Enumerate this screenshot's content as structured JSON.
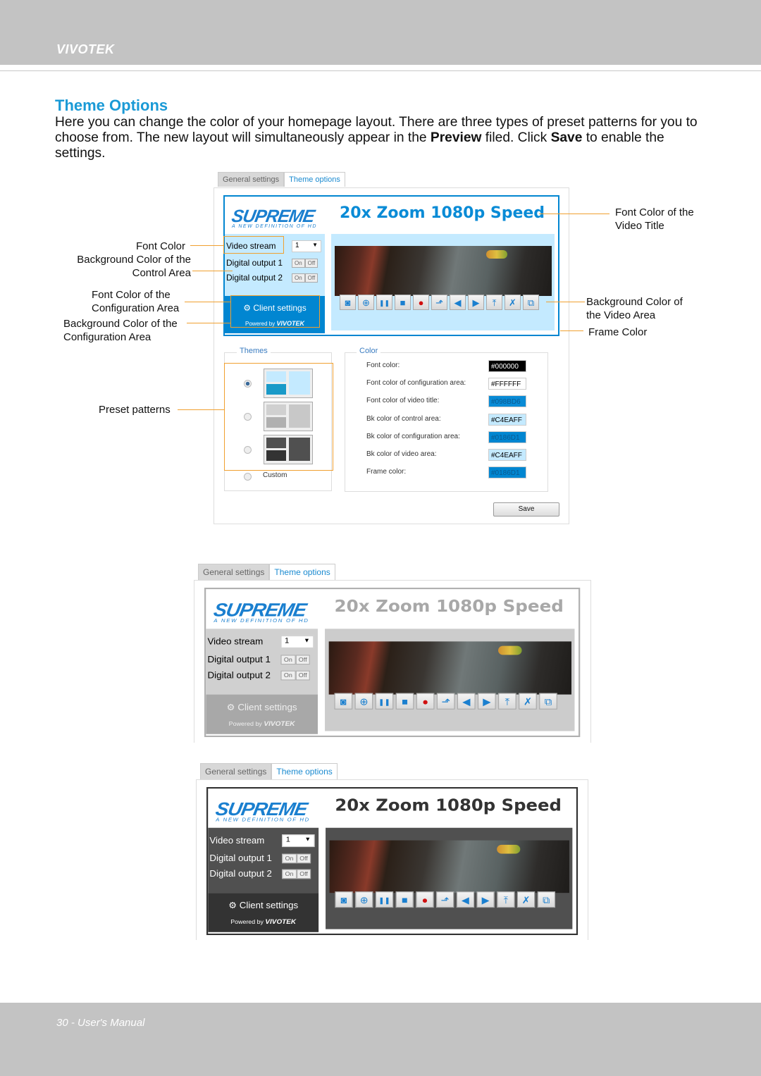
{
  "header": {
    "brand": "VIVOTEK"
  },
  "section": {
    "title": "Theme Options",
    "paragraph_parts": [
      "Here you can change the color of your homepage layout. There are three types of preset patterns for you to choose from. The new layout will simultaneously appear in the ",
      "Preview",
      " filed. Click ",
      "Save",
      " to enable the settings."
    ]
  },
  "callouts": {
    "font_color": "Font Color",
    "bg_control": [
      "Background Color of the",
      "Control Area"
    ],
    "font_config": [
      "Font Color of the",
      "Configuration Area"
    ],
    "bg_config": [
      "Background Color of the",
      "Configuration Area"
    ],
    "preset": "Preset patterns",
    "font_video_title": [
      "Font Color of the",
      "Video Title"
    ],
    "bg_video": [
      "Background Color of",
      "the Video Area"
    ],
    "frame": "Frame Color"
  },
  "tabs": {
    "general": "General settings",
    "theme": "Theme options"
  },
  "preview": {
    "logo": "SUPREME",
    "tagline": "A NEW DEFINITION OF HD",
    "video_title": "20x Zoom 1080p Speed",
    "video_stream_label": "Video stream",
    "video_stream_value": "1",
    "digital_output_1": "Digital output 1",
    "digital_output_2": "Digital output 2",
    "on": "On",
    "off": "Off",
    "client_settings": "Client settings",
    "powered_by": "Powered by",
    "powered_brand": "VIVOTEK",
    "buttons": [
      "snapshot-icon",
      "zoom-icon",
      "pause-icon",
      "stop-icon",
      "record-icon",
      "pan-icon",
      "speaker-icon",
      "talk-icon",
      "upload-icon",
      "mute-mic-icon",
      "fullscreen-icon"
    ]
  },
  "themes": [
    {
      "frame": "#0186D1",
      "title": "#098BD6",
      "control_bg": "#C4EAFF",
      "font": "#000000",
      "config_bg": "#0186D1",
      "config_font": "#FFFFFF",
      "video_bg": "#C4EAFF"
    },
    {
      "frame": "#B0B0B0",
      "title": "#A8A8A8",
      "control_bg": "#D0D0D0",
      "font": "#000000",
      "config_bg": "#A8A8A8",
      "config_font": "#EEEEEE",
      "video_bg": "#CCCCCC"
    },
    {
      "frame": "#333333",
      "title": "#333333",
      "control_bg": "#505050",
      "font": "#FFFFFF",
      "config_bg": "#333333",
      "config_font": "#FFFFFF",
      "video_bg": "#505050"
    }
  ],
  "themes_panel": {
    "legend": "Themes",
    "selected": 0,
    "custom_label": "Custom",
    "thumbs": [
      {
        "a": "#C4EAFF",
        "b": "#1A9AC8",
        "c": "#C4EAFF"
      },
      {
        "a": "#D0D0D0",
        "b": "#B0B0B0",
        "c": "#C8C8C8"
      },
      {
        "a": "#505050",
        "b": "#333333",
        "c": "#505050"
      }
    ]
  },
  "color_panel": {
    "legend": "Color",
    "rows": [
      {
        "label": "Font color:",
        "value": "#000000",
        "bg": "#000000",
        "fg": "#FFFFFF"
      },
      {
        "label": "Font color of configuration area:",
        "value": "#FFFFFF",
        "bg": "#FFFFFF",
        "fg": "#000000"
      },
      {
        "label": "Font color of video title:",
        "value": "#098BD6",
        "bg": "#098BD6",
        "fg": "#0A5A90"
      },
      {
        "label": "Bk color of control area:",
        "value": "#C4EAFF",
        "bg": "#C4EAFF",
        "fg": "#000000"
      },
      {
        "label": "Bk color of configuration area:",
        "value": "#0186D1",
        "bg": "#0186D1",
        "fg": "#0A5A90"
      },
      {
        "label": "Bk color of video area:",
        "value": "#C4EAFF",
        "bg": "#C4EAFF",
        "fg": "#000000"
      },
      {
        "label": "Frame color:",
        "value": "#0186D1",
        "bg": "#0186D1",
        "fg": "#0A5A90"
      }
    ],
    "save": "Save"
  },
  "footer": {
    "text": "30 - User's Manual"
  }
}
